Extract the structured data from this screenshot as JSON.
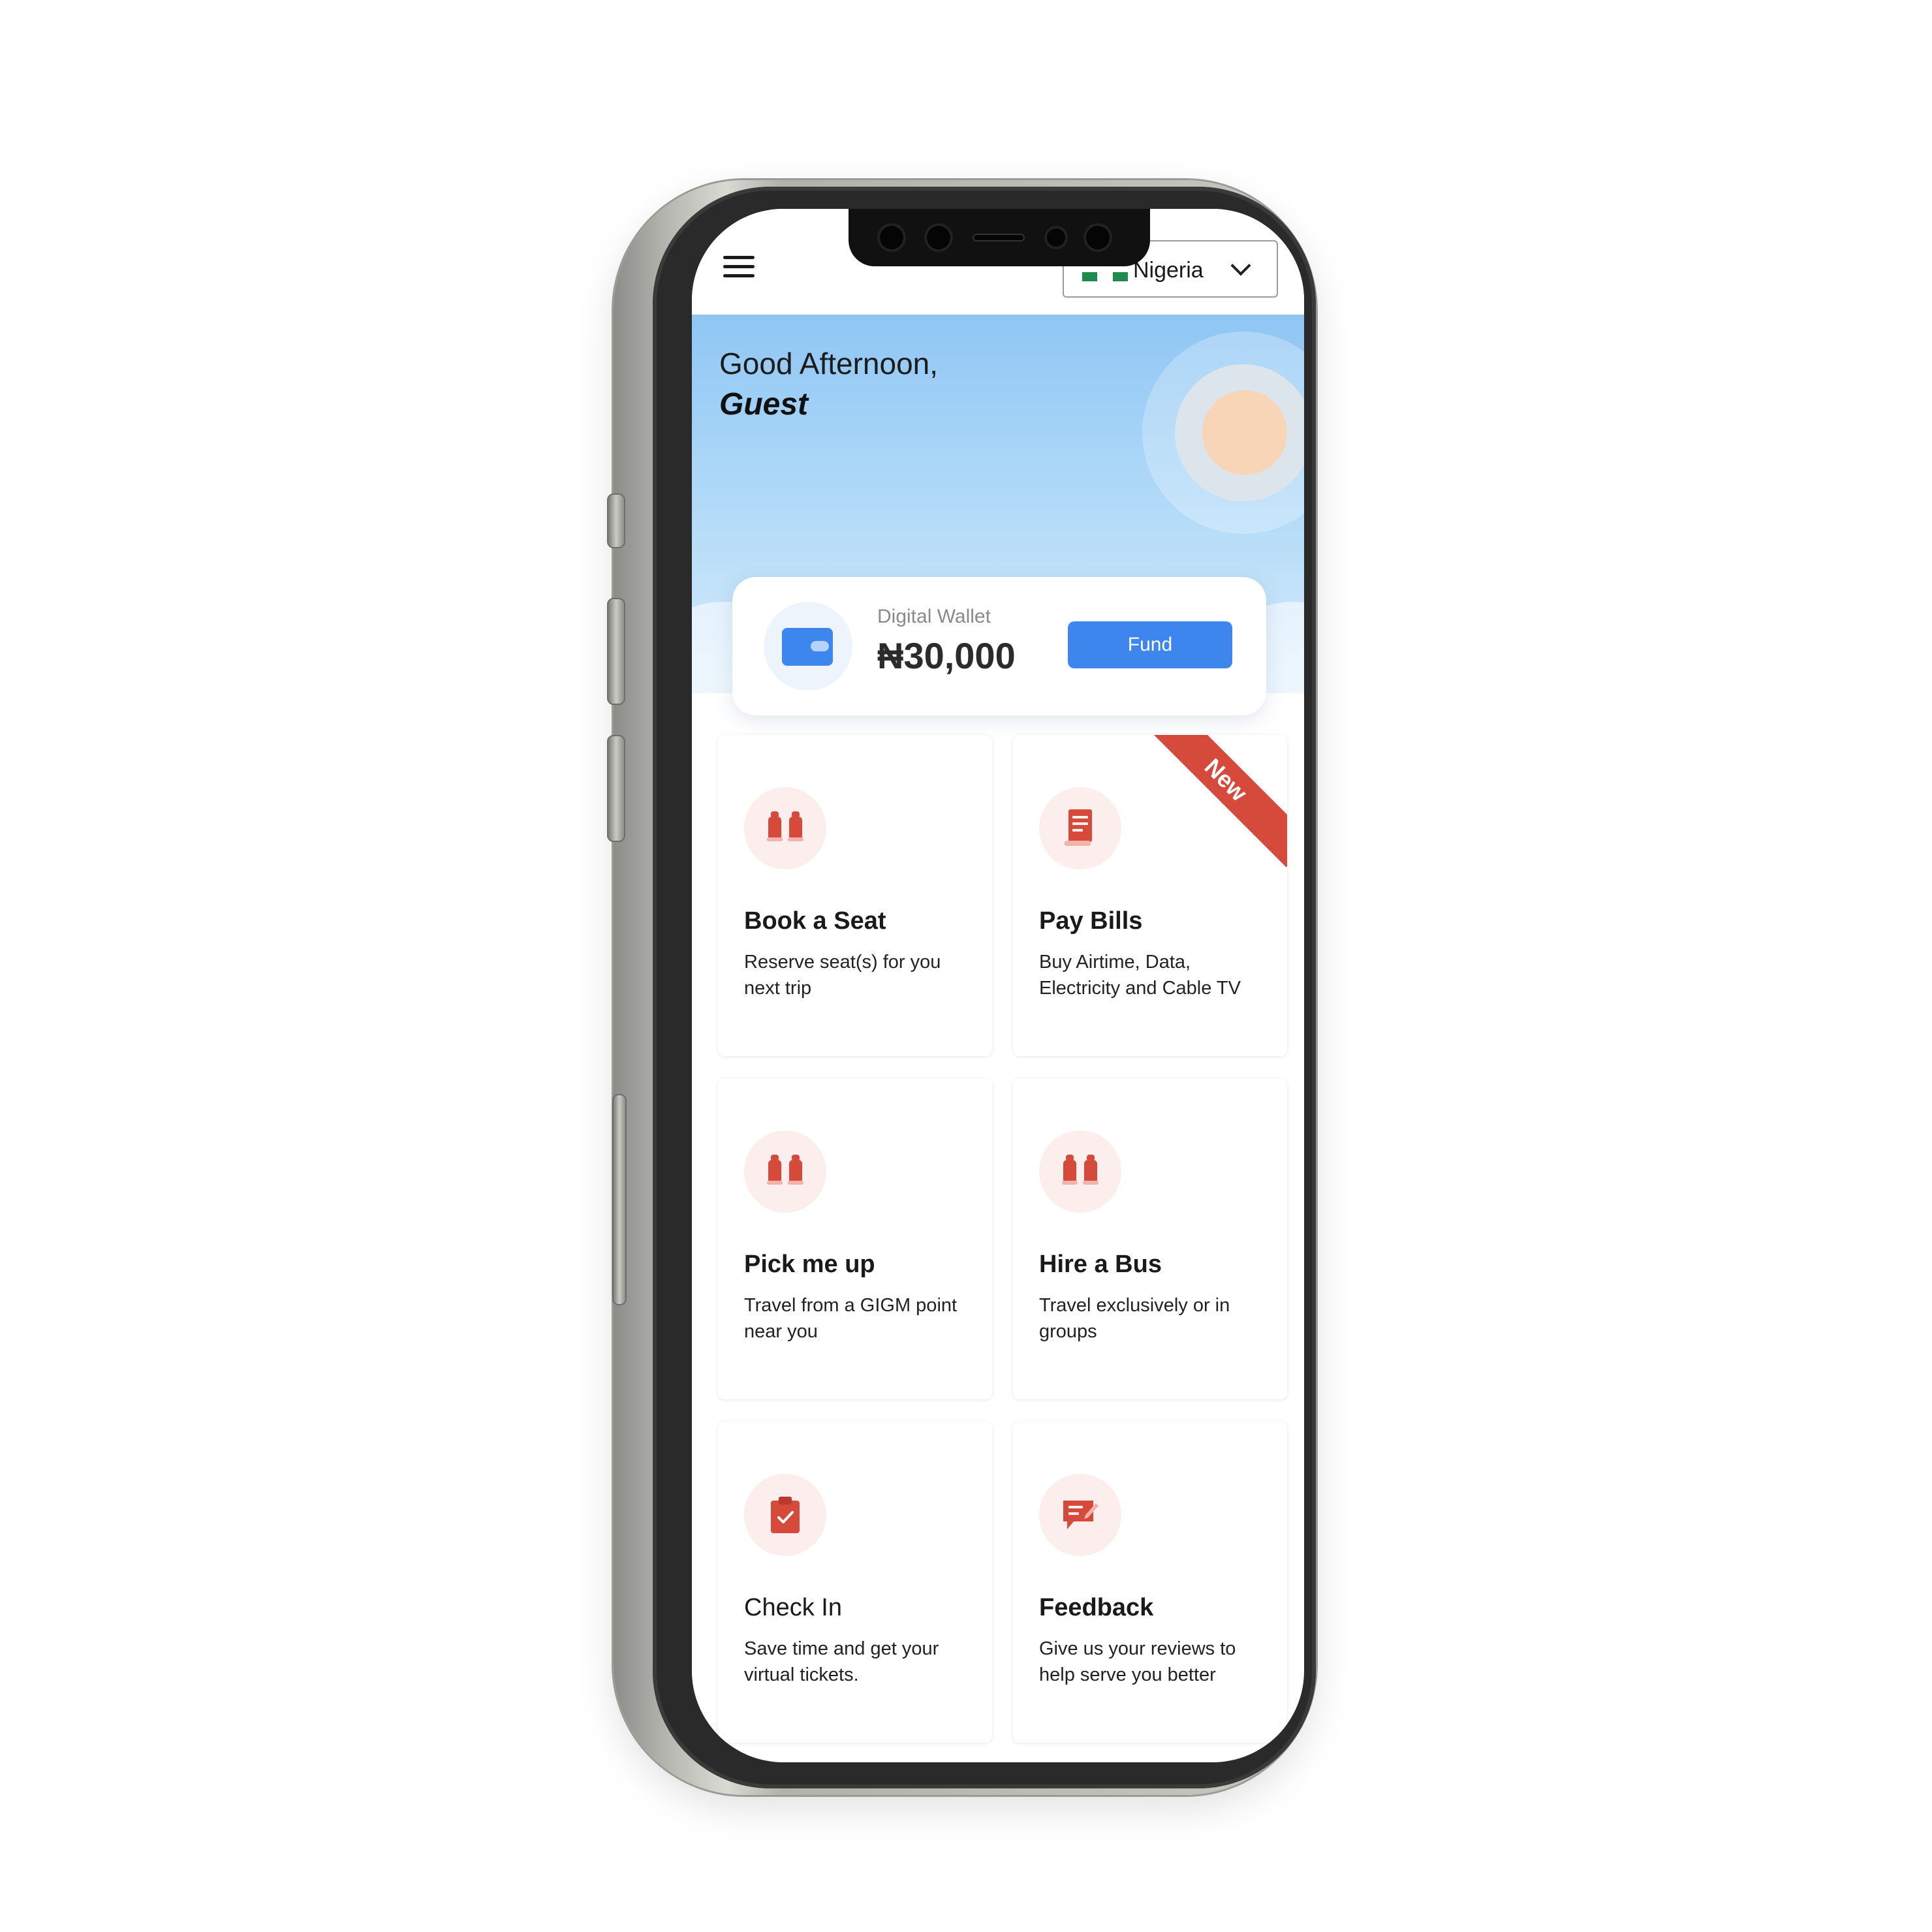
{
  "topbar": {
    "country": "Nigeria"
  },
  "hero": {
    "greeting": "Good Afternoon,",
    "name": "Guest"
  },
  "wallet": {
    "label": "Digital Wallet",
    "amount": "₦30,000",
    "fund_label": "Fund"
  },
  "tiles": [
    {
      "title": "Book a Seat",
      "desc": "Reserve seat(s) for you next trip",
      "icon": "seats-icon"
    },
    {
      "title": "Pay Bills",
      "desc": "Buy Airtime, Data, Electricity and Cable TV",
      "icon": "bill-icon",
      "badge": "New"
    },
    {
      "title": "Pick me up",
      "desc": "Travel from a GIGM point near you",
      "icon": "seats-icon"
    },
    {
      "title": "Hire a Bus",
      "desc": "Travel exclusively or in groups",
      "icon": "seats-icon"
    },
    {
      "title": "Check In",
      "desc": "Save time and get your virtual tickets.",
      "icon": "clipboard-check-icon"
    },
    {
      "title": "Feedback",
      "desc": "Give us your reviews to help serve you better",
      "icon": "feedback-icon"
    }
  ],
  "colors": {
    "accent": "#3d86ee",
    "icon_red": "#d64a3b",
    "icon_bg": "#fdeeee",
    "flag_green": "#1e8a4c"
  }
}
